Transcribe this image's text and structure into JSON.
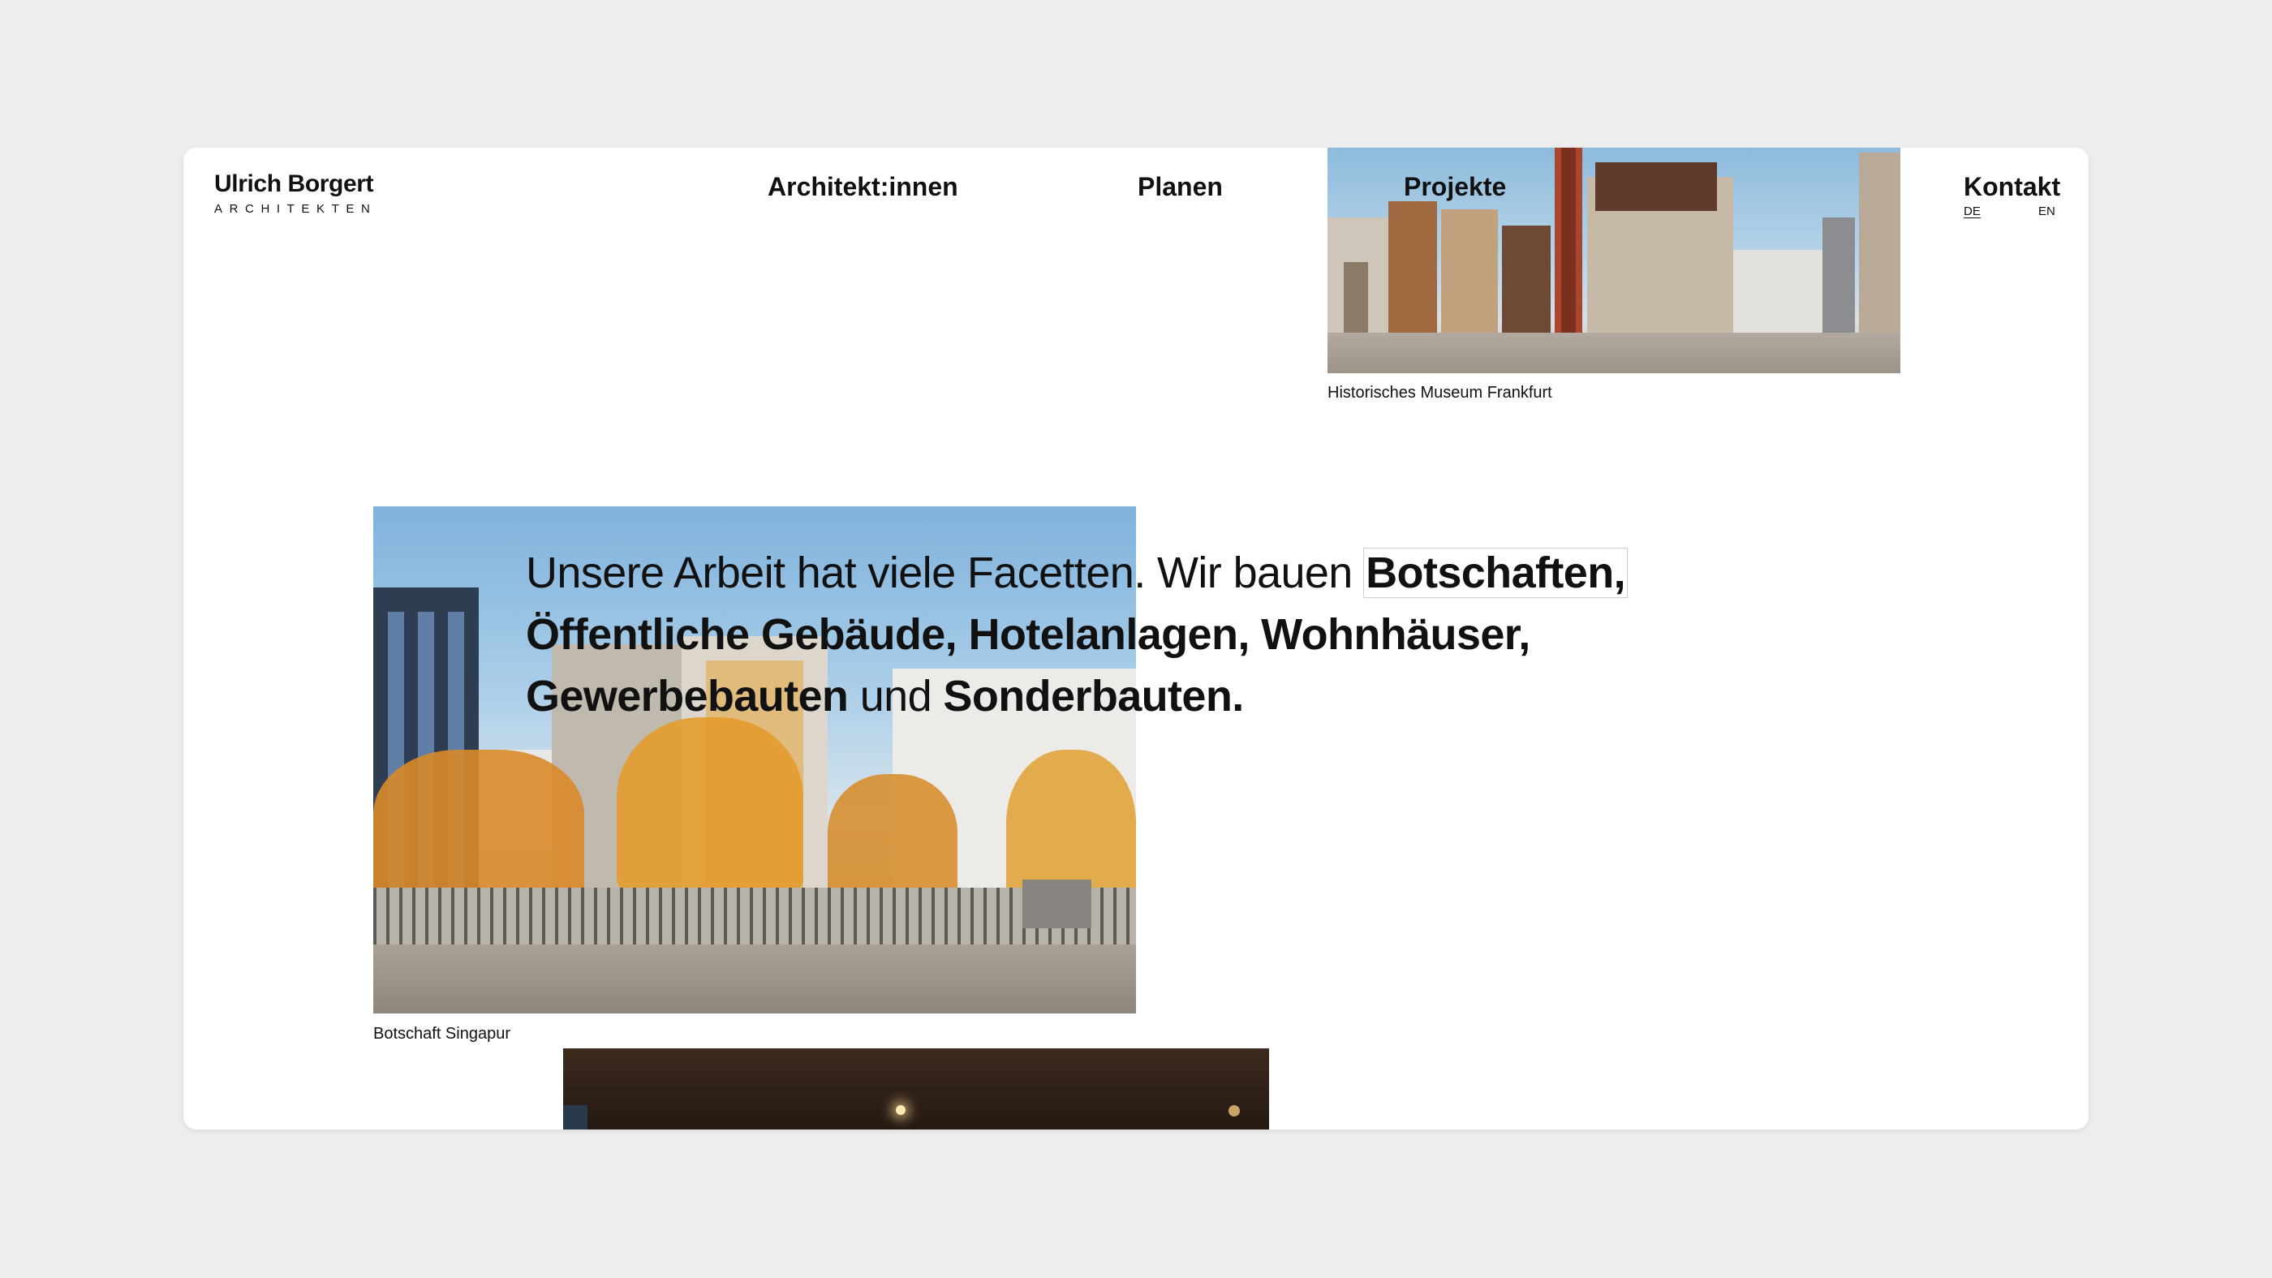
{
  "brand": {
    "name": "Ulrich Borgert",
    "subtitle": "ARCHITEKTEN"
  },
  "nav": {
    "architekten": "Architekt:innen",
    "planen": "Planen",
    "projekte": "Projekte",
    "kontakt": "Kontakt"
  },
  "languages": {
    "de": "DE",
    "en": "EN",
    "active": "DE"
  },
  "headline": {
    "intro": "Unsere Arbeit hat viele Facetten. Wir bauen",
    "item1": "Botschaften,",
    "item2": "Öffentliche Gebäude,",
    "item3": "Hotelanlagen,",
    "item4": "Wohnhäuser,",
    "item5": "Gewerbebauten",
    "connector": "und",
    "item6": "Sonderbauten."
  },
  "projects": [
    {
      "caption": "Historisches Museum Frankfurt"
    },
    {
      "caption": "Botschaft Singapur"
    }
  ],
  "colors": {
    "background": "#ededed",
    "card": "#ffffff",
    "text": "#111111"
  }
}
